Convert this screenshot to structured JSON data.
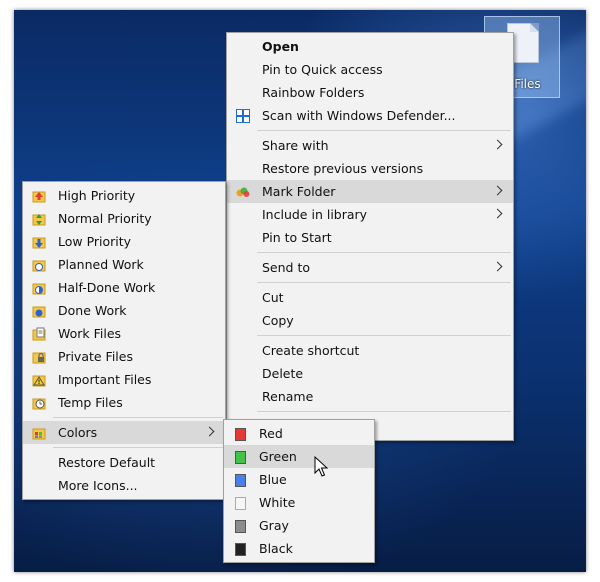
{
  "desktop": {
    "icon_label": "y Files"
  },
  "context_menu": {
    "items": [
      {
        "label": "Open",
        "bold": true
      },
      {
        "label": "Pin to Quick access"
      },
      {
        "label": "Rainbow Folders"
      },
      {
        "label": "Scan with Windows Defender...",
        "icon": "windows-defender-icon"
      },
      {
        "label": "Share with",
        "submenu": true
      },
      {
        "label": "Restore previous versions"
      },
      {
        "label": "Mark Folder",
        "submenu": true,
        "icon": "mark-folder-icon",
        "highlighted": true
      },
      {
        "label": "Include in library",
        "submenu": true
      },
      {
        "label": "Pin to Start"
      },
      {
        "label": "Send to",
        "submenu": true
      },
      {
        "label": "Cut"
      },
      {
        "label": "Copy"
      },
      {
        "label": "Create shortcut"
      },
      {
        "label": "Delete"
      },
      {
        "label": "Rename"
      }
    ]
  },
  "mark_folder_menu": {
    "items": [
      {
        "label": "High Priority",
        "icon": "high-priority-icon"
      },
      {
        "label": "Normal Priority",
        "icon": "normal-priority-icon"
      },
      {
        "label": "Low Priority",
        "icon": "low-priority-icon"
      },
      {
        "label": "Planned Work",
        "icon": "planned-work-icon"
      },
      {
        "label": "Half-Done Work",
        "icon": "half-done-work-icon"
      },
      {
        "label": "Done Work",
        "icon": "done-work-icon"
      },
      {
        "label": "Work Files",
        "icon": "work-files-icon"
      },
      {
        "label": "Private Files",
        "icon": "private-files-icon"
      },
      {
        "label": "Important Files",
        "icon": "important-files-icon"
      },
      {
        "label": "Temp Files",
        "icon": "temp-files-icon"
      },
      {
        "label": "Colors",
        "icon": "colors-icon",
        "submenu": true,
        "highlighted": true
      },
      {
        "label": "Restore Default"
      },
      {
        "label": "More Icons..."
      }
    ]
  },
  "colors_menu": {
    "items": [
      {
        "label": "Red",
        "color": "#e53935"
      },
      {
        "label": "Green",
        "color": "#43c24a",
        "highlighted": true
      },
      {
        "label": "Blue",
        "color": "#4a7ee8"
      },
      {
        "label": "White",
        "color": "#f6f6f6"
      },
      {
        "label": "Gray",
        "color": "#8c8c8c"
      },
      {
        "label": "Black",
        "color": "#222222"
      }
    ]
  },
  "colors": {
    "menu_bg": "#f2f2f2",
    "highlight": "#d9d9d9",
    "desktop_blue": "#0e3f8a"
  }
}
